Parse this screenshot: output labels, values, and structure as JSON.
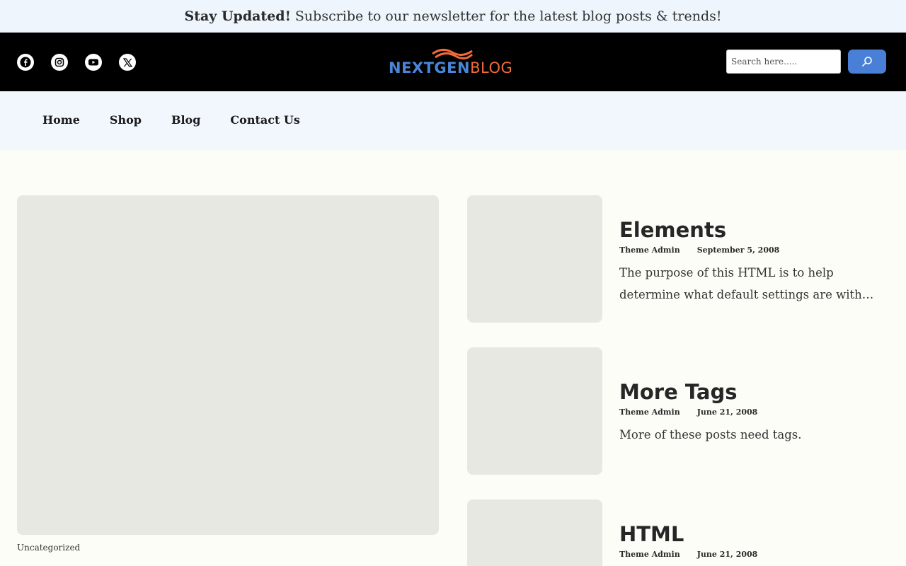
{
  "announcement": {
    "bold": "Stay Updated!",
    "text": "Subscribe to our newsletter for the latest blog posts & trends!"
  },
  "social": [
    {
      "icon": "facebook-icon"
    },
    {
      "icon": "instagram-icon"
    },
    {
      "icon": "youtube-icon"
    },
    {
      "icon": "x-icon"
    }
  ],
  "logo": {
    "part1": "NEXTGEN",
    "part2": "BLOG"
  },
  "search": {
    "placeholder": "Search here.....",
    "button_icon": "search-icon"
  },
  "nav": {
    "items": [
      "Home",
      "Shop",
      "Blog",
      "Contact Us"
    ]
  },
  "featured": {
    "category": "Uncategorized"
  },
  "posts": [
    {
      "title": "Elements",
      "author": "Theme Admin",
      "date": "September 5, 2008",
      "excerpt": "The purpose of this HTML is to help determine what default settings are with…"
    },
    {
      "title": "More Tags",
      "author": "Theme Admin",
      "date": "June 21, 2008",
      "excerpt": "More of these posts need tags."
    },
    {
      "title": "HTML",
      "author": "Theme Admin",
      "date": "June 21, 2008",
      "excerpt": ""
    }
  ],
  "colors": {
    "announcement_bg": "#eef5fc",
    "header_bg": "#000000",
    "nav_bg": "#f2f7fd",
    "page_bg": "#fdfdf7",
    "placeholder_bg": "#e8e8e3",
    "accent_blue": "#4a7fd8",
    "logo_orange": "#f06b3a"
  }
}
